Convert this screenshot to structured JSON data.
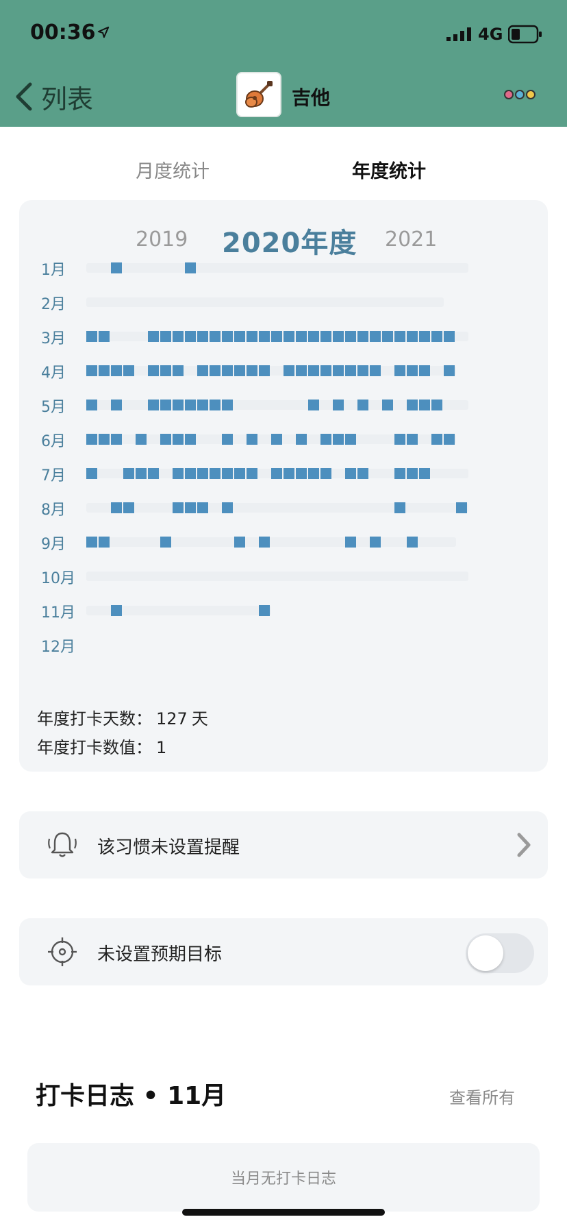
{
  "status_bar": {
    "time": "00:36",
    "network": "4G"
  },
  "nav": {
    "back_label": "列表",
    "title": "吉他",
    "more_dot_colors": [
      "#e06a8a",
      "#5db3d6",
      "#f1c84a"
    ]
  },
  "tabs": {
    "month": "月度统计",
    "year": "年度统计",
    "active": "year"
  },
  "year_nav": {
    "prev": "2019",
    "current": "2020年度",
    "next": "2021"
  },
  "heatmap": {
    "months": [
      {
        "label": "1月",
        "checked_days": [
          2,
          8
        ]
      },
      {
        "label": "2月",
        "checked_days": []
      },
      {
        "label": "3月",
        "checked_days": [
          0,
          1,
          5,
          6,
          7,
          8,
          9,
          10,
          11,
          12,
          13,
          14,
          15,
          16,
          17,
          18,
          19,
          20,
          21,
          22,
          23,
          24,
          25,
          26,
          27,
          28,
          29
        ]
      },
      {
        "label": "4月",
        "checked_days": [
          0,
          1,
          2,
          3,
          5,
          6,
          7,
          9,
          10,
          11,
          12,
          13,
          14,
          16,
          17,
          18,
          19,
          20,
          21,
          22,
          23,
          25,
          26,
          27,
          29
        ]
      },
      {
        "label": "5月",
        "checked_days": [
          0,
          2,
          5,
          6,
          7,
          8,
          9,
          10,
          11,
          18,
          20,
          22,
          24,
          26,
          27,
          28
        ]
      },
      {
        "label": "6月",
        "checked_days": [
          0,
          1,
          2,
          4,
          6,
          7,
          8,
          11,
          13,
          15,
          17,
          19,
          20,
          21,
          25,
          26,
          28,
          29
        ]
      },
      {
        "label": "7月",
        "checked_days": [
          0,
          3,
          4,
          5,
          7,
          8,
          9,
          10,
          11,
          12,
          13,
          15,
          16,
          17,
          18,
          19,
          21,
          22,
          25,
          26,
          27
        ]
      },
      {
        "label": "8月",
        "checked_days": [
          2,
          3,
          7,
          8,
          9,
          11,
          25,
          30
        ]
      },
      {
        "label": "9月",
        "checked_days": [
          0,
          1,
          6,
          12,
          14,
          21,
          23,
          26
        ]
      },
      {
        "label": "10月",
        "checked_days": []
      },
      {
        "label": "11月",
        "checked_days": [
          2,
          14
        ]
      },
      {
        "label": "12月",
        "checked_days": []
      }
    ],
    "track_days": [
      31,
      29,
      31,
      30,
      31,
      30,
      31,
      31,
      30,
      31,
      15,
      0
    ]
  },
  "stats": {
    "days_label": "年度打卡天数：",
    "days_value": "127",
    "days_unit": "天",
    "value_label": "年度打卡数值：",
    "value_value": "1"
  },
  "reminder": {
    "label": "该习惯未设置提醒",
    "icon": "bell-icon"
  },
  "goal": {
    "label": "未设置预期目标",
    "icon": "target-icon",
    "toggle_on": false
  },
  "log": {
    "title": "打卡日志 • 11月",
    "see_all": "查看所有",
    "empty": "当月无打卡日志"
  }
}
